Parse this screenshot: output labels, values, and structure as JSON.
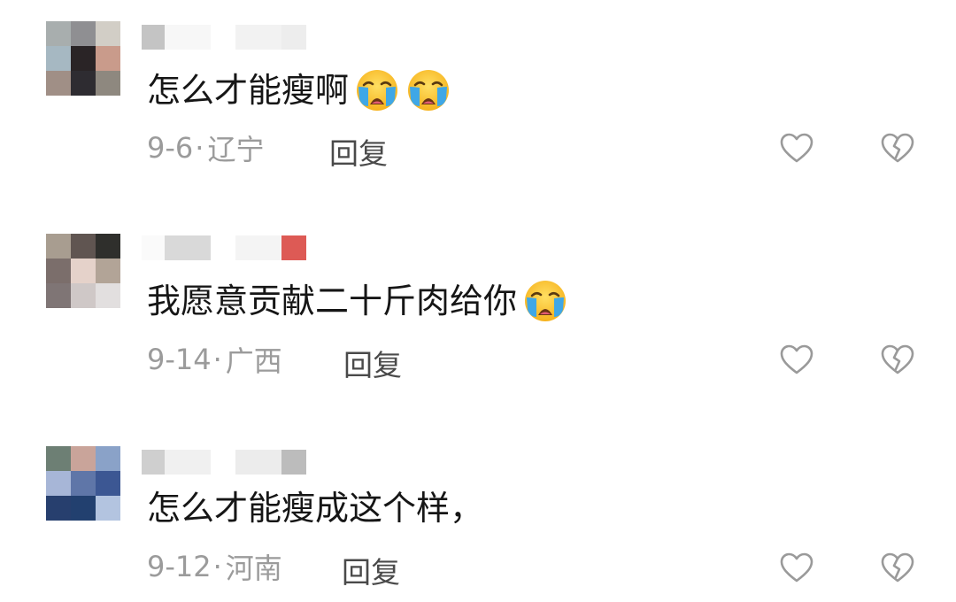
{
  "comments": [
    {
      "text": "怎么才能瘦啊",
      "emoji_count": 2,
      "emoji": "loudly-crying-face",
      "date": "9-6",
      "location": "辽宁",
      "reply_label": "回复",
      "avatar_colors": [
        "#a8aeae",
        "#8f8f92",
        "#d2cec6",
        "#a6b8c2",
        "#2a2426",
        "#c99b8b",
        "#a08f86",
        "#2e2c31",
        "#8e887f"
      ],
      "name_colors": [
        "#c4c4c4",
        "#f7f7f7",
        "#f2f2f2",
        "#ededed"
      ]
    },
    {
      "text": "我愿意贡献二十斤肉给你",
      "emoji_count": 1,
      "emoji": "loudly-crying-face",
      "date": "9-14",
      "location": "广西",
      "reply_label": "回复",
      "avatar_colors": [
        "#a89d90",
        "#605551",
        "#2f2f2c",
        "#7b6e6b",
        "#e5d2ca",
        "#b2a497",
        "#7f7575",
        "#cfc8c7",
        "#e2dfdf"
      ],
      "name_colors": [
        "#fafafa",
        "#d9d9d9",
        "#f4f4f4",
        "#dd5a55"
      ]
    },
    {
      "text": "怎么才能瘦成这个样，",
      "emoji_count": 0,
      "emoji": "",
      "date": "9-12",
      "location": "河南",
      "reply_label": "回复",
      "avatar_colors": [
        "#6d7f74",
        "#c9a49a",
        "#8aa2c8",
        "#a7b6d7",
        "#5f76a8",
        "#3c5793",
        "#273f6e",
        "#22406f",
        "#b3c4e0"
      ],
      "name_colors": [
        "#cfcfcf",
        "#f0f0f0",
        "#ececec",
        "#bcbcbc"
      ]
    }
  ],
  "icons": {
    "like": "heart-outline-icon",
    "dislike": "broken-heart-icon"
  },
  "colors": {
    "comment_text": "#161616",
    "meta_text": "#9b9b9b",
    "reply_text": "#4a4a4a",
    "icon_stroke": "#9a9a9a"
  }
}
